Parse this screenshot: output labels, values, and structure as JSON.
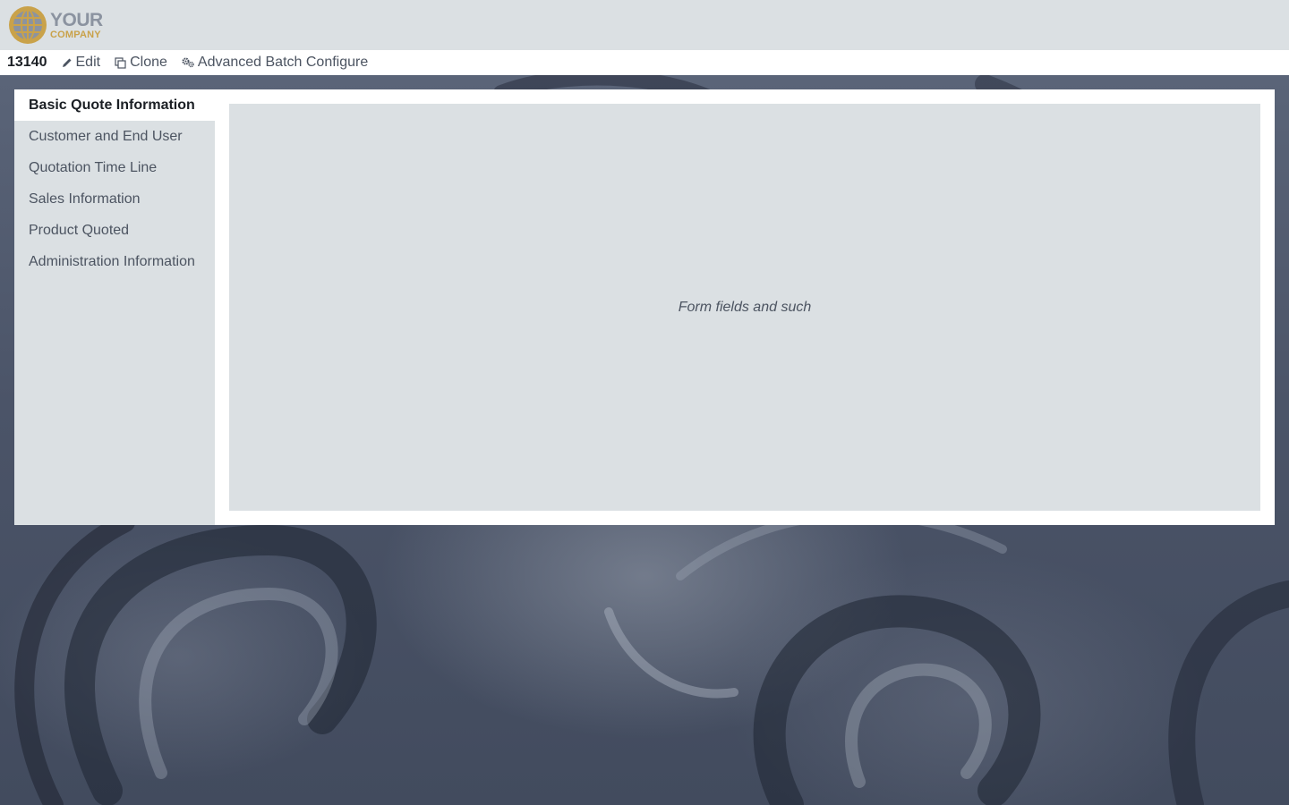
{
  "header": {
    "logo": {
      "line1": "YOUR",
      "line2": "COMPANY",
      "icon": "globe-icon"
    }
  },
  "toolbar": {
    "record_id": "13140",
    "edit_label": "Edit",
    "edit_icon": "pencil-icon",
    "clone_label": "Clone",
    "clone_icon": "copy-icon",
    "batch_label": "Advanced Batch Configure",
    "batch_icon": "gears-icon"
  },
  "sidenav": {
    "items": [
      {
        "label": "Basic Quote Information",
        "active": true
      },
      {
        "label": "Customer and End User",
        "active": false
      },
      {
        "label": "Quotation Time Line",
        "active": false
      },
      {
        "label": "Sales Information",
        "active": false
      },
      {
        "label": "Product Quoted",
        "active": false
      },
      {
        "label": "Administration Information",
        "active": false
      }
    ]
  },
  "content": {
    "placeholder": "Form fields and such"
  },
  "colors": {
    "header_bg": "#dbe0e3",
    "logo_gold": "#c9a24a",
    "logo_gray": "#8b93a0",
    "text": "#4c5461",
    "text_strong": "#1b1f24"
  }
}
